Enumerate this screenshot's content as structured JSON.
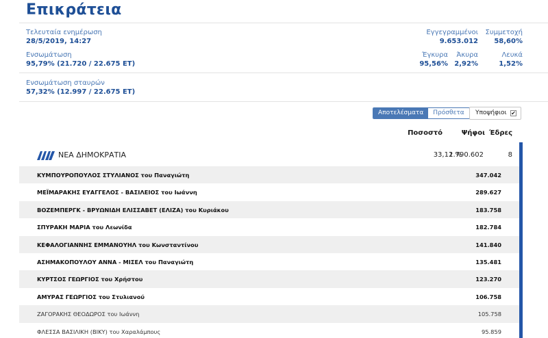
{
  "header": {
    "title": "Επικράτεια"
  },
  "stats": {
    "last_update": {
      "label": "Τελευταία ενημέρωση",
      "value": "28/5/2019, 14:27"
    },
    "integration": {
      "label": "Ενσωμάτωση",
      "value": "95,79% (21.720 / 22.675 ΕΤ)"
    },
    "cross_integration": {
      "label": "Ενσωμάτωση σταυρών",
      "value": "57,32% (12.997 / 22.675 ΕΤ)"
    },
    "registered": {
      "label": "Εγγεγραμμένοι",
      "value": "9.653.012"
    },
    "turnout": {
      "label": "Συμμετοχή",
      "value": "58,60%"
    },
    "valid": {
      "label": "Έγκυρα",
      "value": "95,56%"
    },
    "invalid": {
      "label": "Άκυρα",
      "value": "2,92%"
    },
    "blank": {
      "label": "Λευκά",
      "value": "1,52%"
    }
  },
  "toolbar": {
    "results_label": "Αποτελέσματα",
    "added_label": "Πρόσθετα",
    "candidates_label": "Υποψήφιοι",
    "candidates_checked": "✔"
  },
  "table": {
    "headers": {
      "percent": "Ποσοστό",
      "votes": "Ψήφοι",
      "seats": "Έδρες"
    },
    "party": {
      "name": "ΝΕΑ ΔΗΜΟΚΡΑΤΙΑ",
      "percent": "33,12 %",
      "votes": "1.790.602",
      "seats": "8",
      "color": "#2456a8"
    },
    "candidates": [
      {
        "name": "ΚΥΜΠΟΥΡΟΠΟΥΛΟΣ ΣΤΥΛΙΑΝΟΣ του Παναγιώτη",
        "votes": "347.042"
      },
      {
        "name": "ΜΕΪΜΑΡΑΚΗΣ ΕΥΑΓΓΕΛΟΣ - ΒΑΣΙΛΕΙΟΣ του Ιωάννη",
        "votes": "289.627"
      },
      {
        "name": "ΒΟΖΕΜΠΕΡΓΚ - ΒΡΥΩΝΙΔΗ ΕΛΙΣΣΑΒΕΤ (ΕΛΙΖΑ) του Κυριάκου",
        "votes": "183.758"
      },
      {
        "name": "ΣΠΥΡΑΚΗ ΜΑΡΙΑ του Λεωνίδα",
        "votes": "182.784"
      },
      {
        "name": "ΚΕΦΑΛΟΓΙΑΝΝΗΣ ΕΜΜΑΝΟΥΗΛ του Κωνσταντίνου",
        "votes": "141.840"
      },
      {
        "name": "ΑΣΗΜΑΚΟΠΟΥΛΟΥ ΑΝΝΑ - ΜΙΣΕΛ του Παναγιώτη",
        "votes": "135.481"
      },
      {
        "name": "ΚΥΡΤΣΟΣ ΓΕΩΡΓΙΟΣ του Χρήστου",
        "votes": "123.270"
      },
      {
        "name": "ΑΜΥΡΑΣ ΓΕΩΡΓΙΟΣ του Στυλιανού",
        "votes": "106.758"
      },
      {
        "name": "ΖΑΓΟΡΑΚΗΣ ΘΕΟΔΩΡΟΣ του Ιωάννη",
        "votes": "105.758"
      },
      {
        "name": "ΦΛΕΣΣΑ ΒΑΣΙΛΙΚΗ (ΒΙΚΥ) του Χαραλάμπους",
        "votes": "95.859"
      }
    ]
  }
}
